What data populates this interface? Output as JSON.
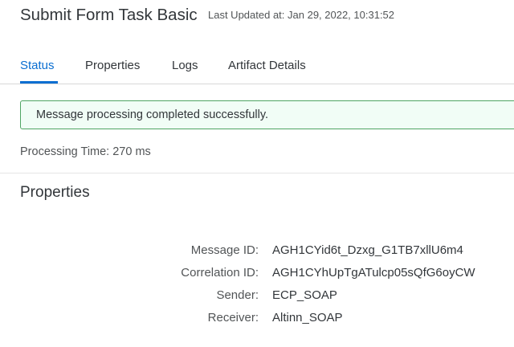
{
  "header": {
    "title": "Submit Form Task Basic",
    "last_updated": "Last Updated at: Jan 29, 2022, 10:31:52"
  },
  "tabs": [
    {
      "label": "Status",
      "active": true
    },
    {
      "label": "Properties",
      "active": false
    },
    {
      "label": "Logs",
      "active": false
    },
    {
      "label": "Artifact Details",
      "active": false
    }
  ],
  "status": {
    "message": "Message processing completed successfully.",
    "processing_label": "Processing Time:",
    "processing_value": "270 ms"
  },
  "properties": {
    "title": "Properties",
    "rows": [
      {
        "label": "Message ID:",
        "value": "AGH1CYid6t_Dzxg_G1TB7xllU6m4"
      },
      {
        "label": "Correlation ID:",
        "value": "AGH1CYhUpTgATulcp05sQfG6oyCW"
      },
      {
        "label": "Sender:",
        "value": "ECP_SOAP"
      },
      {
        "label": "Receiver:",
        "value": "Altinn_SOAP"
      }
    ]
  },
  "colors": {
    "accent": "#0a6ed1",
    "success_border": "#4fa563",
    "success_bg": "#f1fdf6",
    "text": "#32363a"
  }
}
